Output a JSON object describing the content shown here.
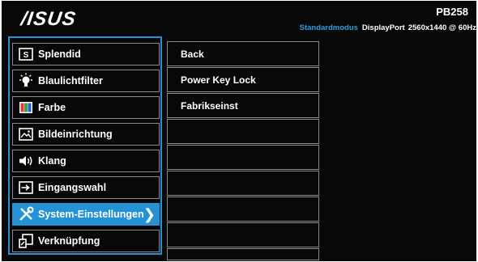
{
  "header": {
    "logo": "/ISUS",
    "model": "PB258",
    "mode": "Standardmodus",
    "input": "DisplayPort",
    "resolution": "2560x1440 @ 60Hz"
  },
  "main_menu": [
    {
      "label": "Splendid",
      "icon": "splendid-s-icon"
    },
    {
      "label": "Blaulichtfilter",
      "icon": "bulb-icon"
    },
    {
      "label": "Farbe",
      "icon": "color-icon"
    },
    {
      "label": "Bildeinrichtung",
      "icon": "image-icon"
    },
    {
      "label": "Klang",
      "icon": "speaker-icon"
    },
    {
      "label": "Eingangswahl",
      "icon": "input-icon"
    },
    {
      "label": "System-Einstellungen",
      "icon": "tools-icon",
      "selected": true
    },
    {
      "label": "Verknüpfung",
      "icon": "shortcut-icon"
    }
  ],
  "sub_menu": [
    {
      "label": "Back"
    },
    {
      "label": "Power Key Lock"
    },
    {
      "label": "Fabrikseinst"
    },
    {
      "label": ""
    },
    {
      "label": ""
    },
    {
      "label": ""
    },
    {
      "label": ""
    },
    {
      "label": ""
    },
    {
      "label": ""
    }
  ],
  "colors": {
    "accent": "#2592d6",
    "background": "#080808",
    "border": "#8a8a8a"
  }
}
